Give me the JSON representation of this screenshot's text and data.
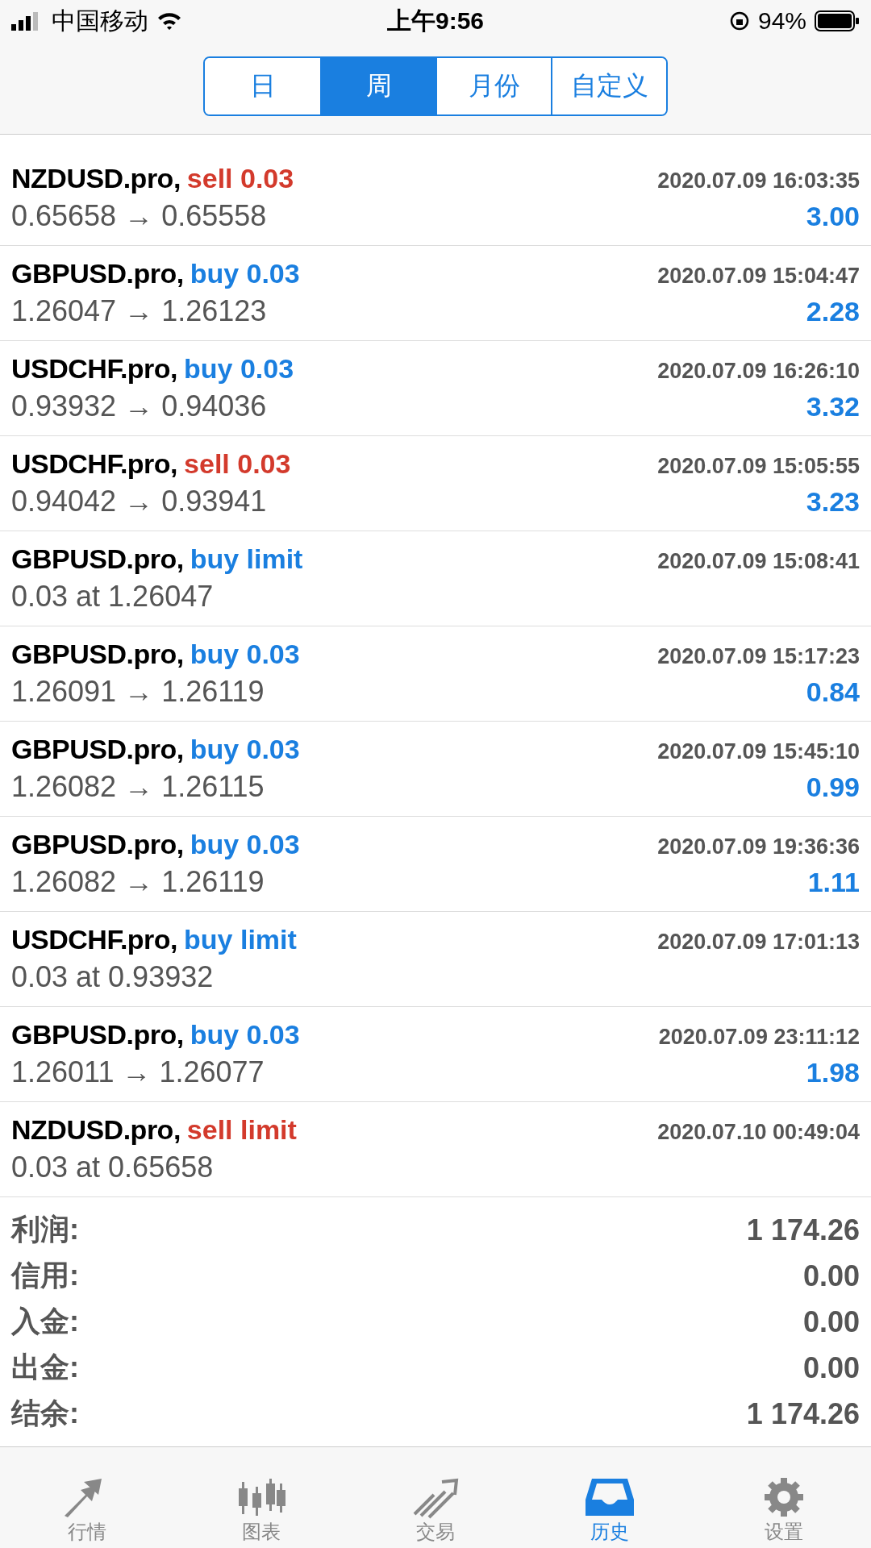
{
  "status_bar": {
    "carrier": "中国移动",
    "time": "上午9:56",
    "battery": "94%"
  },
  "periods": [
    {
      "label": "日",
      "selected": false
    },
    {
      "label": "周",
      "selected": true
    },
    {
      "label": "月份",
      "selected": false
    },
    {
      "label": "自定义",
      "selected": false
    }
  ],
  "deals": [
    {
      "symbol": "NZDUSD.pro,",
      "type": "sell 0.03",
      "color": "#d33a2c",
      "time": "2020.07.09 16:03:35",
      "prices": "0.65658 → 0.65558",
      "profit": "3.00"
    },
    {
      "symbol": "GBPUSD.pro,",
      "type": "buy 0.03",
      "color": "#1a7fe0",
      "time": "2020.07.09 15:04:47",
      "prices": "1.26047 → 1.26123",
      "profit": "2.28"
    },
    {
      "symbol": "USDCHF.pro,",
      "type": "buy 0.03",
      "color": "#1a7fe0",
      "time": "2020.07.09 16:26:10",
      "prices": "0.93932 → 0.94036",
      "profit": "3.32"
    },
    {
      "symbol": "USDCHF.pro,",
      "type": "sell 0.03",
      "color": "#d33a2c",
      "time": "2020.07.09 15:05:55",
      "prices": "0.94042 → 0.93941",
      "profit": "3.23"
    },
    {
      "symbol": "GBPUSD.pro,",
      "type": "buy limit",
      "color": "#1a7fe0",
      "time": "2020.07.09 15:08:41",
      "prices": "0.03 at 1.26047"
    },
    {
      "symbol": "GBPUSD.pro,",
      "type": "buy 0.03",
      "color": "#1a7fe0",
      "time": "2020.07.09 15:17:23",
      "prices": "1.26091 → 1.26119",
      "profit": "0.84"
    },
    {
      "symbol": "GBPUSD.pro,",
      "type": "buy 0.03",
      "color": "#1a7fe0",
      "time": "2020.07.09 15:45:10",
      "prices": "1.26082 → 1.26115",
      "profit": "0.99"
    },
    {
      "symbol": "GBPUSD.pro,",
      "type": "buy 0.03",
      "color": "#1a7fe0",
      "time": "2020.07.09 19:36:36",
      "prices": "1.26082 → 1.26119",
      "profit": "1.11"
    },
    {
      "symbol": "USDCHF.pro,",
      "type": "buy limit",
      "color": "#1a7fe0",
      "time": "2020.07.09 17:01:13",
      "prices": "0.03 at 0.93932"
    },
    {
      "symbol": "GBPUSD.pro,",
      "type": "buy 0.03",
      "color": "#1a7fe0",
      "time": "2020.07.09 23:11:12",
      "prices": "1.26011 → 1.26077",
      "profit": "1.98"
    },
    {
      "symbol": "NZDUSD.pro,",
      "type": "sell limit",
      "color": "#d33a2c",
      "time": "2020.07.10 00:49:04",
      "prices": "0.03 at 0.65658"
    }
  ],
  "summary": [
    {
      "label": "利润:",
      "value": "1 174.26"
    },
    {
      "label": "信用:",
      "value": "0.00"
    },
    {
      "label": "入金:",
      "value": "0.00"
    },
    {
      "label": "出金:",
      "value": "0.00"
    },
    {
      "label": "结余:",
      "value": "1 174.26"
    }
  ],
  "tab_bar": [
    {
      "kind": "quotes",
      "label": "行情",
      "selected": false
    },
    {
      "kind": "chart",
      "label": "图表",
      "selected": false
    },
    {
      "kind": "trade",
      "label": "交易",
      "selected": false
    },
    {
      "kind": "history",
      "label": "历史",
      "selected": true
    },
    {
      "kind": "settings",
      "label": "设置",
      "selected": false
    }
  ]
}
